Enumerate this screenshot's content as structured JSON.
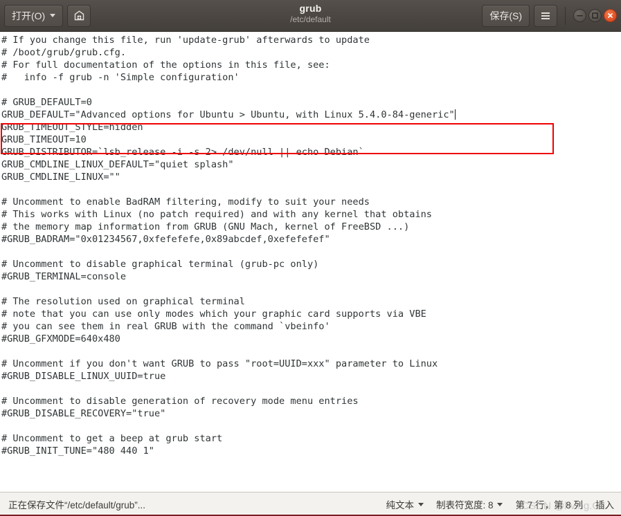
{
  "titlebar": {
    "open_label": "打开(O)",
    "open_icon": "chevron-down-icon",
    "save_as_icon": "save-as-icon",
    "title": "grub",
    "subtitle": "/etc/default",
    "save_label": "保存(S)",
    "menu_icon": "hamburger-menu-icon",
    "minimize_icon": "minimize-icon",
    "maximize_icon": "maximize-icon",
    "close_icon": "close-icon",
    "bg_color": "#4b4642",
    "title_color": "#f4f1ed",
    "subtitle_color": "#b4afa9"
  },
  "editor": {
    "lines": [
      "# If you change this file, run 'update-grub' afterwards to update",
      "# /boot/grub/grub.cfg.",
      "# For full documentation of the options in this file, see:",
      "#   info -f grub -n 'Simple configuration'",
      "",
      "# GRUB_DEFAULT=0",
      "GRUB_DEFAULT=\"Advanced options for Ubuntu > Ubuntu, with Linux 5.4.0-84-generic\"",
      "GRUB_TIMEOUT_STYLE=hidden",
      "GRUB_TIMEOUT=10",
      "GRUB_DISTRIBUTOR=`lsb_release -i -s 2> /dev/null || echo Debian`",
      "GRUB_CMDLINE_LINUX_DEFAULT=\"quiet splash\"",
      "GRUB_CMDLINE_LINUX=\"\"",
      "",
      "# Uncomment to enable BadRAM filtering, modify to suit your needs",
      "# This works with Linux (no patch required) and with any kernel that obtains",
      "# the memory map information from GRUB (GNU Mach, kernel of FreeBSD ...)",
      "#GRUB_BADRAM=\"0x01234567,0xfefefefe,0x89abcdef,0xefefefef\"",
      "",
      "# Uncomment to disable graphical terminal (grub-pc only)",
      "#GRUB_TERMINAL=console",
      "",
      "# The resolution used on graphical terminal",
      "# note that you can use only modes which your graphic card supports via VBE",
      "# you can see them in real GRUB with the command `vbeinfo'",
      "#GRUB_GFXMODE=640x480",
      "",
      "# Uncomment if you don't want GRUB to pass \"root=UUID=xxx\" parameter to Linux",
      "#GRUB_DISABLE_LINUX_UUID=true",
      "",
      "# Uncomment to disable generation of recovery mode menu entries",
      "#GRUB_DISABLE_RECOVERY=\"true\"",
      "",
      "# Uncomment to get a beep at grub start",
      "#GRUB_INIT_TUNE=\"480 440 1\""
    ],
    "caret_line_index": 6,
    "text_color": "#2f3436",
    "background_color": "#ffffff",
    "highlight_box": {
      "color": "#f00000",
      "covers_lines": [
        5,
        6
      ]
    }
  },
  "statusbar": {
    "message": "正在保存文件“/etc/default/grub”...",
    "language": "纯文本",
    "tab_width": "制表符宽度: 8",
    "position": "第 7 行，第 8 列",
    "insert_mode": "插入",
    "bg_color": "#f4f2ef",
    "accent_rule_color": "#7a1d24"
  },
  "watermark": {
    "text": "CSDN @hving.G"
  }
}
